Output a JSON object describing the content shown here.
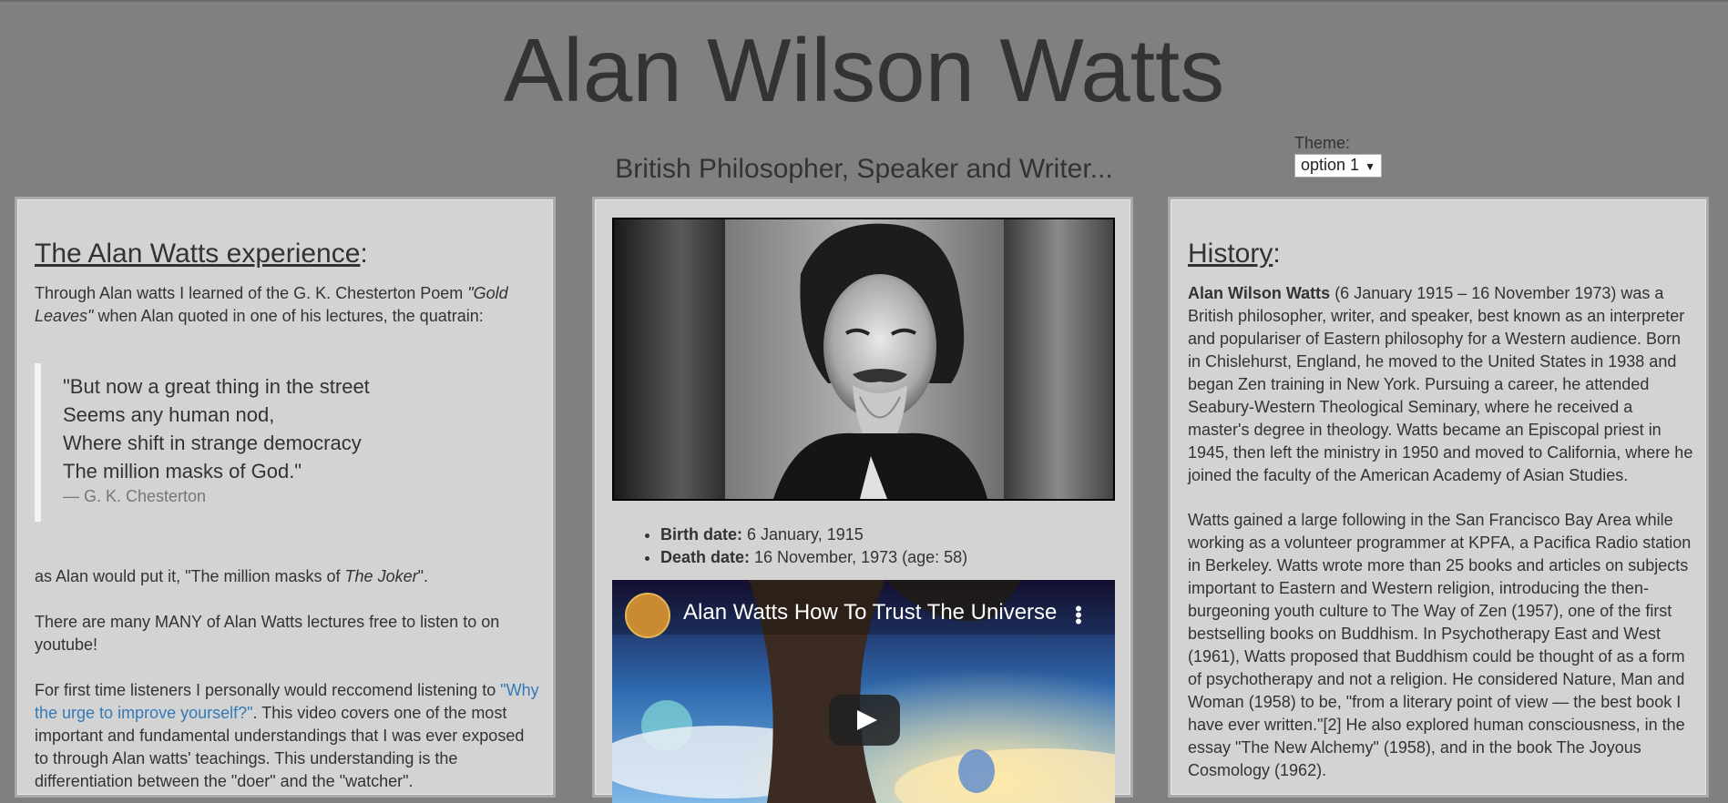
{
  "header": {
    "title": "Alan Wilson Watts",
    "subtitle": "British Philosopher, Speaker and Writer..."
  },
  "theme": {
    "label": "Theme:",
    "selected": "option 1"
  },
  "left_panel": {
    "heading": "The Alan Watts experience",
    "heading_suffix": ":",
    "intro_1": "Through Alan watts I learned of the G. K. Chesterton Poem ",
    "poem_title": "\"Gold Leaves\"",
    "intro_2": " when Alan quoted in one of his lectures, the quatrain:",
    "quote_lines": [
      "\"But now a great thing in the street",
      "Seems any human nod,",
      "Where shift in strange democracy",
      "The million masks of God.\""
    ],
    "quote_cite": "— G. K. Chesterton",
    "joker_1": "as Alan would put it, \"The million masks of ",
    "joker_em": "The Joker",
    "joker_2": "\".",
    "youtube_text": "There are many MANY of Alan Watts lectures free to listen to on youtube!",
    "recommend_1": "For first time listeners I personally would reccomend listening to ",
    "recommend_link": "\"Why the urge to improve yourself?\"",
    "recommend_2": ". This video covers one of the most important and fundamental understandings that I was ever exposed to through Alan watts' teachings. This understanding is the differentiation between the \"doer\" and the \"watcher\"."
  },
  "middle_panel": {
    "birth_label": "Birth date:",
    "birth_value": " 6 January, 1915",
    "death_label": "Death date:",
    "death_value": " 16 November, 1973 (age: 58)",
    "video_title": "Alan Watts How To Trust The Universe"
  },
  "right_panel": {
    "heading": "History",
    "heading_suffix": ":",
    "para1_bold": "Alan Wilson Watts",
    "para1": " (6 January 1915 – 16 November 1973) was a British philosopher, writer, and speaker, best known as an interpreter and populariser of Eastern philosophy for a Western audience. Born in Chislehurst, England, he moved to the United States in 1938 and began Zen training in New York. Pursuing a career, he attended Seabury-Western Theological Seminary, where he received a master's degree in theology. Watts became an Episcopal priest in 1945, then left the ministry in 1950 and moved to California, where he joined the faculty of the American Academy of Asian Studies.",
    "para2": "Watts gained a large following in the San Francisco Bay Area while working as a volunteer programmer at KPFA, a Pacifica Radio station in Berkeley. Watts wrote more than 25 books and articles on subjects important to Eastern and Western religion, introducing the then-burgeoning youth culture to The Way of Zen (1957), one of the first bestselling books on Buddhism. In Psychotherapy East and West (1961), Watts proposed that Buddhism could be thought of as a form of psychotherapy and not a religion. He considered Nature, Man and Woman (1958) to be, \"from a literary point of view — the best book I have ever written.\"[2] He also explored human consciousness, in the essay \"The New Alchemy\" (1958), and in the book The Joyous Cosmology (1962)."
  },
  "colors": {
    "background": "#808080",
    "panel": "#d3d3d3",
    "text": "#333333",
    "link": "#337ab7"
  },
  "icons": {
    "select_caret": "caret-down-icon",
    "video_menu": "kebab-menu-icon",
    "video_play": "play-icon",
    "channel_avatar": "avatar"
  }
}
